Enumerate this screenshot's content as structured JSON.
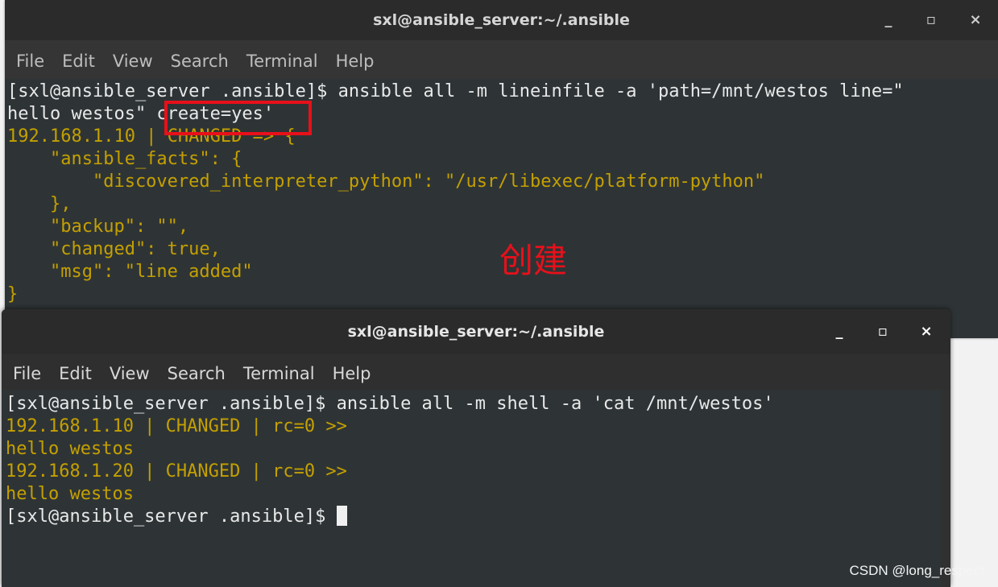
{
  "window_top": {
    "title": "sxl@ansible_server:~/.ansible",
    "controls": {
      "minimize": "_",
      "maximize": "▫",
      "close": "×"
    },
    "menu": [
      "File",
      "Edit",
      "View",
      "Search",
      "Terminal",
      "Help"
    ],
    "lines": [
      "[sxl@ansible_server .ansible]$ ansible all -m lineinfile -a 'path=/mnt/westos line=\"",
      "hello westos\" create=yes'",
      "192.168.1.10 | CHANGED => {",
      "    \"ansible_facts\": {",
      "        \"discovered_interpreter_python\": \"/usr/libexec/platform-python\"",
      "    },",
      "    \"backup\": \"\",",
      "    \"changed\": true,",
      "    \"msg\": \"line added\"",
      "}"
    ],
    "line_colors": [
      "white",
      "white",
      "yellow",
      "yellow",
      "yellow",
      "yellow",
      "yellow",
      "yellow",
      "yellow",
      "yellow"
    ],
    "annotation": "创建"
  },
  "window_bottom": {
    "title": "sxl@ansible_server:~/.ansible",
    "controls": {
      "minimize": "_",
      "maximize": "▫",
      "close": "×"
    },
    "menu": [
      "File",
      "Edit",
      "View",
      "Search",
      "Terminal",
      "Help"
    ],
    "lines": [
      "[sxl@ansible_server .ansible]$ ansible all -m shell -a 'cat /mnt/westos'",
      "192.168.1.10 | CHANGED | rc=0 >>",
      "hello westos",
      "192.168.1.20 | CHANGED | rc=0 >>",
      "hello westos",
      "[sxl@ansible_server .ansible]$ "
    ],
    "line_colors": [
      "white",
      "yellow",
      "yellow",
      "yellow",
      "yellow",
      "white"
    ]
  },
  "watermark": "CSDN @long_respect",
  "colors": {
    "terminal_bg": "#2e3436",
    "prompt_text": "#e8e8e8",
    "output_text": "#c4a000",
    "annotation": "#e8101a"
  }
}
